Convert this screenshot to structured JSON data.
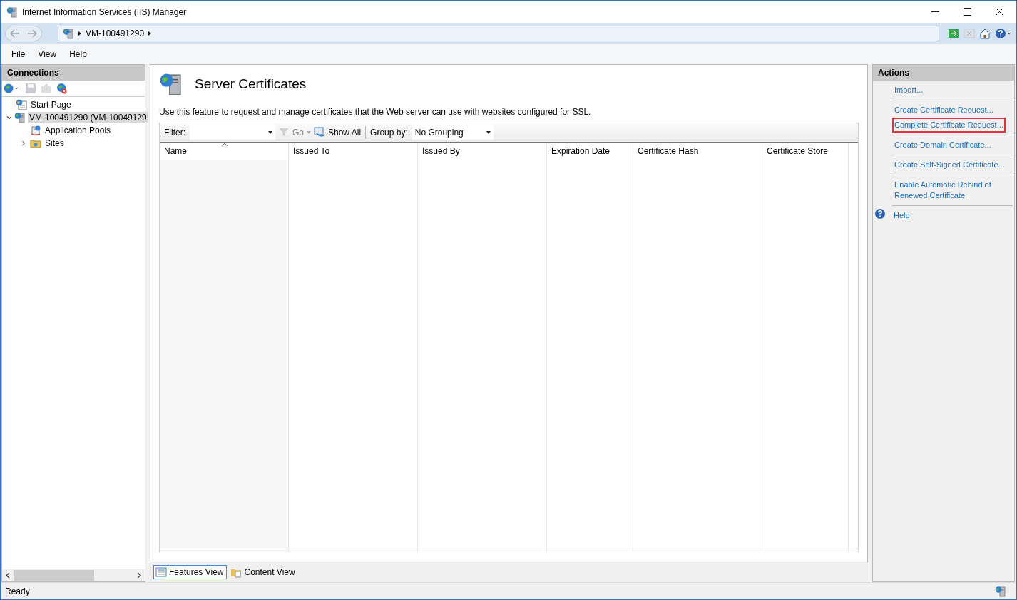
{
  "window": {
    "title": "Internet Information Services (IIS) Manager"
  },
  "breadcrumb": [
    "VM-100491290"
  ],
  "menu": [
    "File",
    "View",
    "Help"
  ],
  "connections": {
    "title": "Connections",
    "tree": [
      {
        "label": "Start Page",
        "kind": "page",
        "selected": false
      },
      {
        "label": "VM-100491290 (VM-10049129",
        "kind": "server",
        "selected": true,
        "expanded": true,
        "children": [
          {
            "label": "Application Pools",
            "kind": "pools",
            "selected": false
          },
          {
            "label": "Sites",
            "kind": "sites",
            "selected": false,
            "expanded": false
          }
        ]
      }
    ]
  },
  "content": {
    "title": "Server Certificates",
    "description": "Use this feature to request and manage certificates that the Web server can use with websites configured for SSL.",
    "filter": {
      "label": "Filter:"
    },
    "go": "Go",
    "show_all": "Show All",
    "group_by": {
      "label": "Group by:",
      "value": "No Grouping"
    },
    "columns": [
      {
        "label": "Name",
        "sorted": true
      },
      {
        "label": "Issued To",
        "sorted": false
      },
      {
        "label": "Issued By",
        "sorted": false
      },
      {
        "label": "Expiration Date",
        "sorted": false
      },
      {
        "label": "Certificate Hash",
        "sorted": false
      },
      {
        "label": "Certificate Store",
        "sorted": false
      }
    ],
    "view_tabs": [
      {
        "label": "Features View",
        "selected": true
      },
      {
        "label": "Content View",
        "selected": false
      }
    ]
  },
  "actions": {
    "title": "Actions",
    "groups": [
      [
        {
          "label": "Import...",
          "highlighted": false
        }
      ],
      [
        {
          "label": "Create Certificate Request...",
          "highlighted": false
        },
        {
          "label": "Complete Certificate Request...",
          "highlighted": true
        }
      ],
      [
        {
          "label": "Create Domain Certificate...",
          "highlighted": false
        }
      ],
      [
        {
          "label": "Create Self-Signed Certificate...",
          "highlighted": false
        }
      ],
      [
        {
          "label": "Enable Automatic Rebind of Renewed Certificate",
          "highlighted": false
        }
      ],
      [
        {
          "label": "Help",
          "highlighted": false,
          "kind": "help"
        }
      ]
    ]
  },
  "status_bar": {
    "text": "Ready"
  }
}
